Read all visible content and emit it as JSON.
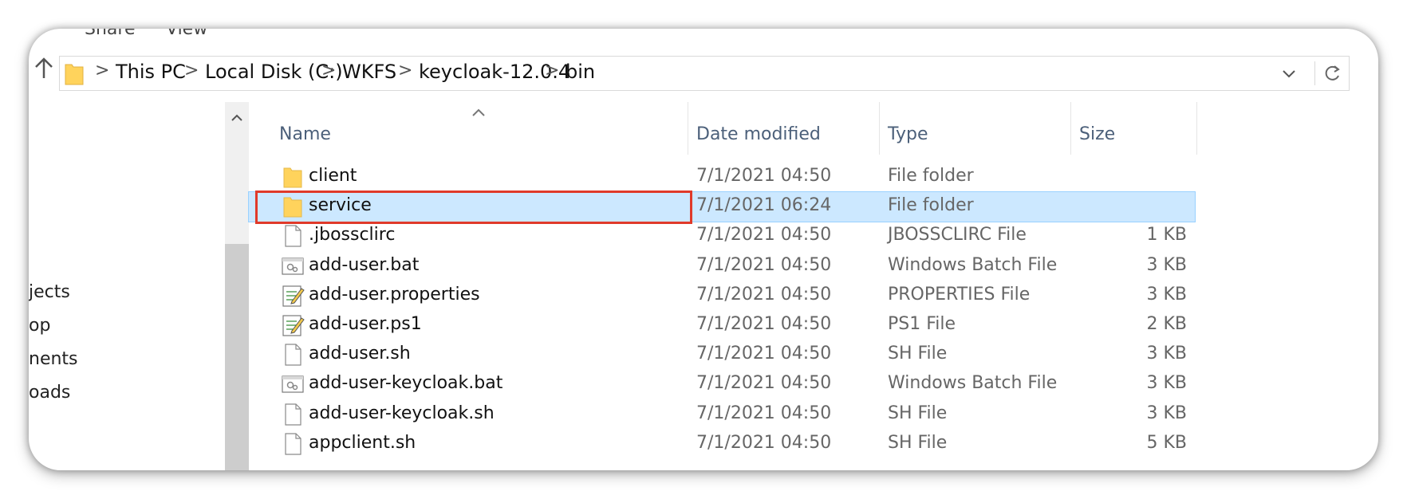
{
  "ribbon": {
    "tabs": [
      "Share",
      "View"
    ]
  },
  "address_bar": {
    "crumbs": [
      "This PC",
      "Local Disk (C:)",
      "WKFS",
      "keycloak-12.0.4",
      "bin"
    ],
    "separator": ">"
  },
  "nav_pane": {
    "items": [
      "jects",
      "op",
      "nents",
      "oads"
    ]
  },
  "columns": {
    "name": "Name",
    "date": "Date modified",
    "type": "Type",
    "size": "Size"
  },
  "files": [
    {
      "name": "client",
      "date": "7/1/2021 04:50",
      "type": "File folder",
      "size": "",
      "icon": "folder-icon"
    },
    {
      "name": "service",
      "date": "7/1/2021 06:24",
      "type": "File folder",
      "size": "",
      "icon": "folder-icon",
      "selected": true
    },
    {
      "name": ".jbossclirc",
      "date": "7/1/2021 04:50",
      "type": "JBOSSCLIRC File",
      "size": "1 KB",
      "icon": "file-icon"
    },
    {
      "name": "add-user.bat",
      "date": "7/1/2021 04:50",
      "type": "Windows Batch File",
      "size": "3 KB",
      "icon": "batch-file-icon"
    },
    {
      "name": "add-user.properties",
      "date": "7/1/2021 04:50",
      "type": "PROPERTIES File",
      "size": "3 KB",
      "icon": "text-edit-icon"
    },
    {
      "name": "add-user.ps1",
      "date": "7/1/2021 04:50",
      "type": "PS1 File",
      "size": "2 KB",
      "icon": "text-edit-icon"
    },
    {
      "name": "add-user.sh",
      "date": "7/1/2021 04:50",
      "type": "SH File",
      "size": "3 KB",
      "icon": "file-icon"
    },
    {
      "name": "add-user-keycloak.bat",
      "date": "7/1/2021 04:50",
      "type": "Windows Batch File",
      "size": "3 KB",
      "icon": "batch-file-icon"
    },
    {
      "name": "add-user-keycloak.sh",
      "date": "7/1/2021 04:50",
      "type": "SH File",
      "size": "3 KB",
      "icon": "file-icon"
    },
    {
      "name": "appclient.sh",
      "date": "7/1/2021 04:50",
      "type": "SH File",
      "size": "5 KB",
      "icon": "file-icon"
    }
  ],
  "colors": {
    "selection": "#cce8ff",
    "highlight_box": "#e03a2a",
    "folder": "#ffd35c"
  }
}
